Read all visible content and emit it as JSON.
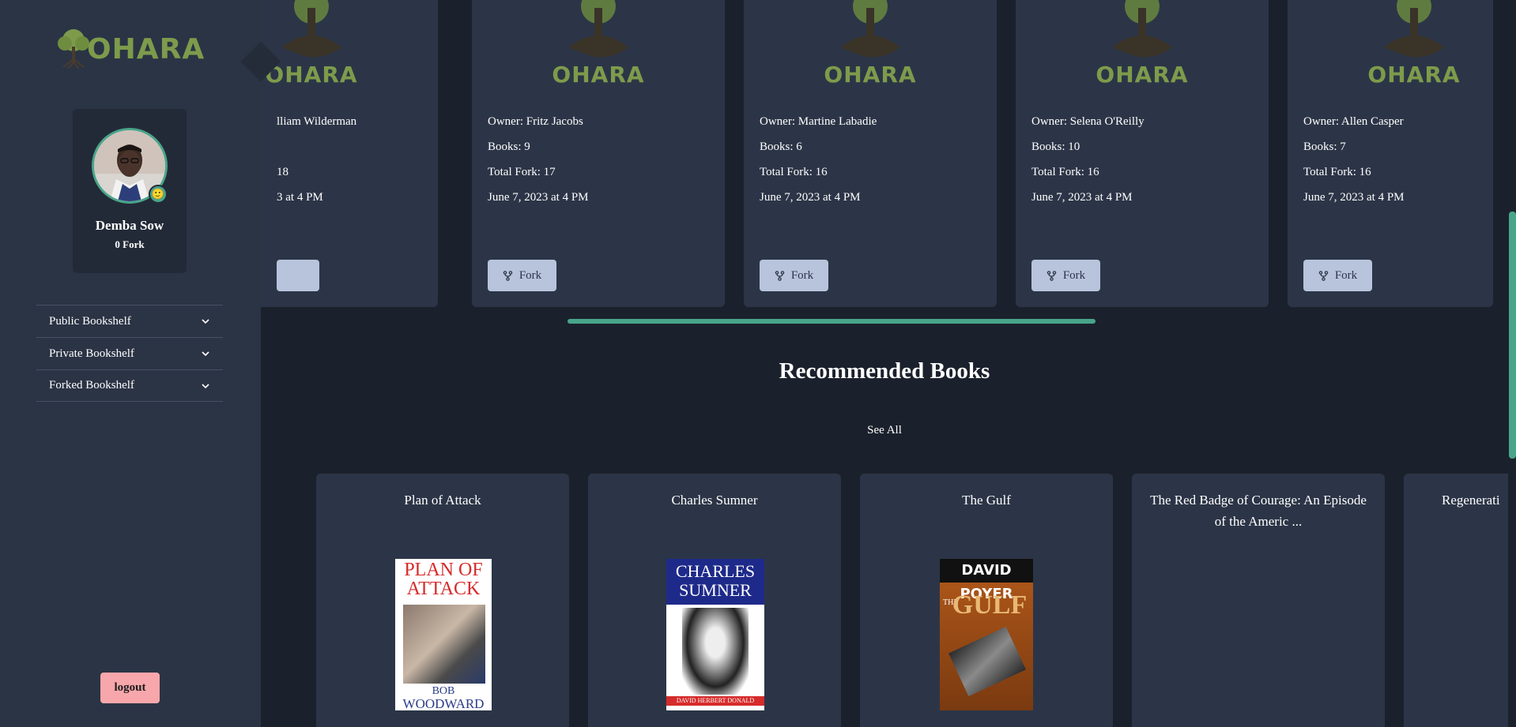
{
  "brand": {
    "name": "OHARA",
    "color": "#7d9b4b"
  },
  "accent": "#48a58a",
  "profile": {
    "name": "Demba Sow",
    "forks": "0 Fork",
    "status_emoji": "🙂"
  },
  "sidebar": {
    "items": [
      {
        "label": "Public Bookshelf"
      },
      {
        "label": "Private Bookshelf"
      },
      {
        "label": "Forked Bookshelf"
      }
    ],
    "logout_label": "logout"
  },
  "bookshelves": [
    {
      "owner": "lliam Wilderman",
      "books": "",
      "total_fork": "18",
      "date": "3 at 4 PM",
      "fork_label": ""
    },
    {
      "owner": "Owner: Fritz Jacobs",
      "books": "Books: 9",
      "total_fork": "Total Fork: 17",
      "date": "June 7, 2023 at 4 PM",
      "fork_label": "Fork"
    },
    {
      "owner": "Owner: Martine Labadie",
      "books": "Books: 6",
      "total_fork": "Total Fork: 16",
      "date": "June 7, 2023 at 4 PM",
      "fork_label": "Fork"
    },
    {
      "owner": "Owner: Selena O'Reilly",
      "books": "Books: 10",
      "total_fork": "Total Fork: 16",
      "date": "June 7, 2023 at 4 PM",
      "fork_label": "Fork"
    },
    {
      "owner": "Owner: Allen Casper",
      "books": "Books: 7",
      "total_fork": "Total Fork: 16",
      "date": "June 7, 2023 at 4 PM",
      "fork_label": "Fork"
    }
  ],
  "recommended": {
    "title": "Recommended Books",
    "see_all": "See All",
    "books": [
      {
        "title": "Plan of Attack",
        "cover_lines": [
          "PLAN OF",
          "ATTACK",
          "BOB",
          "WOODWARD"
        ]
      },
      {
        "title": "Charles Sumner",
        "cover_lines": [
          "CHARLES",
          "SUMNER",
          "DAVID HERBERT DONALD"
        ]
      },
      {
        "title": "The Gulf",
        "cover_lines": [
          "DAVID POYER",
          "GULF",
          "THE"
        ]
      },
      {
        "title": "The Red Badge of Courage: An Episode of the Americ ..."
      },
      {
        "title": "Regenerati"
      }
    ]
  }
}
